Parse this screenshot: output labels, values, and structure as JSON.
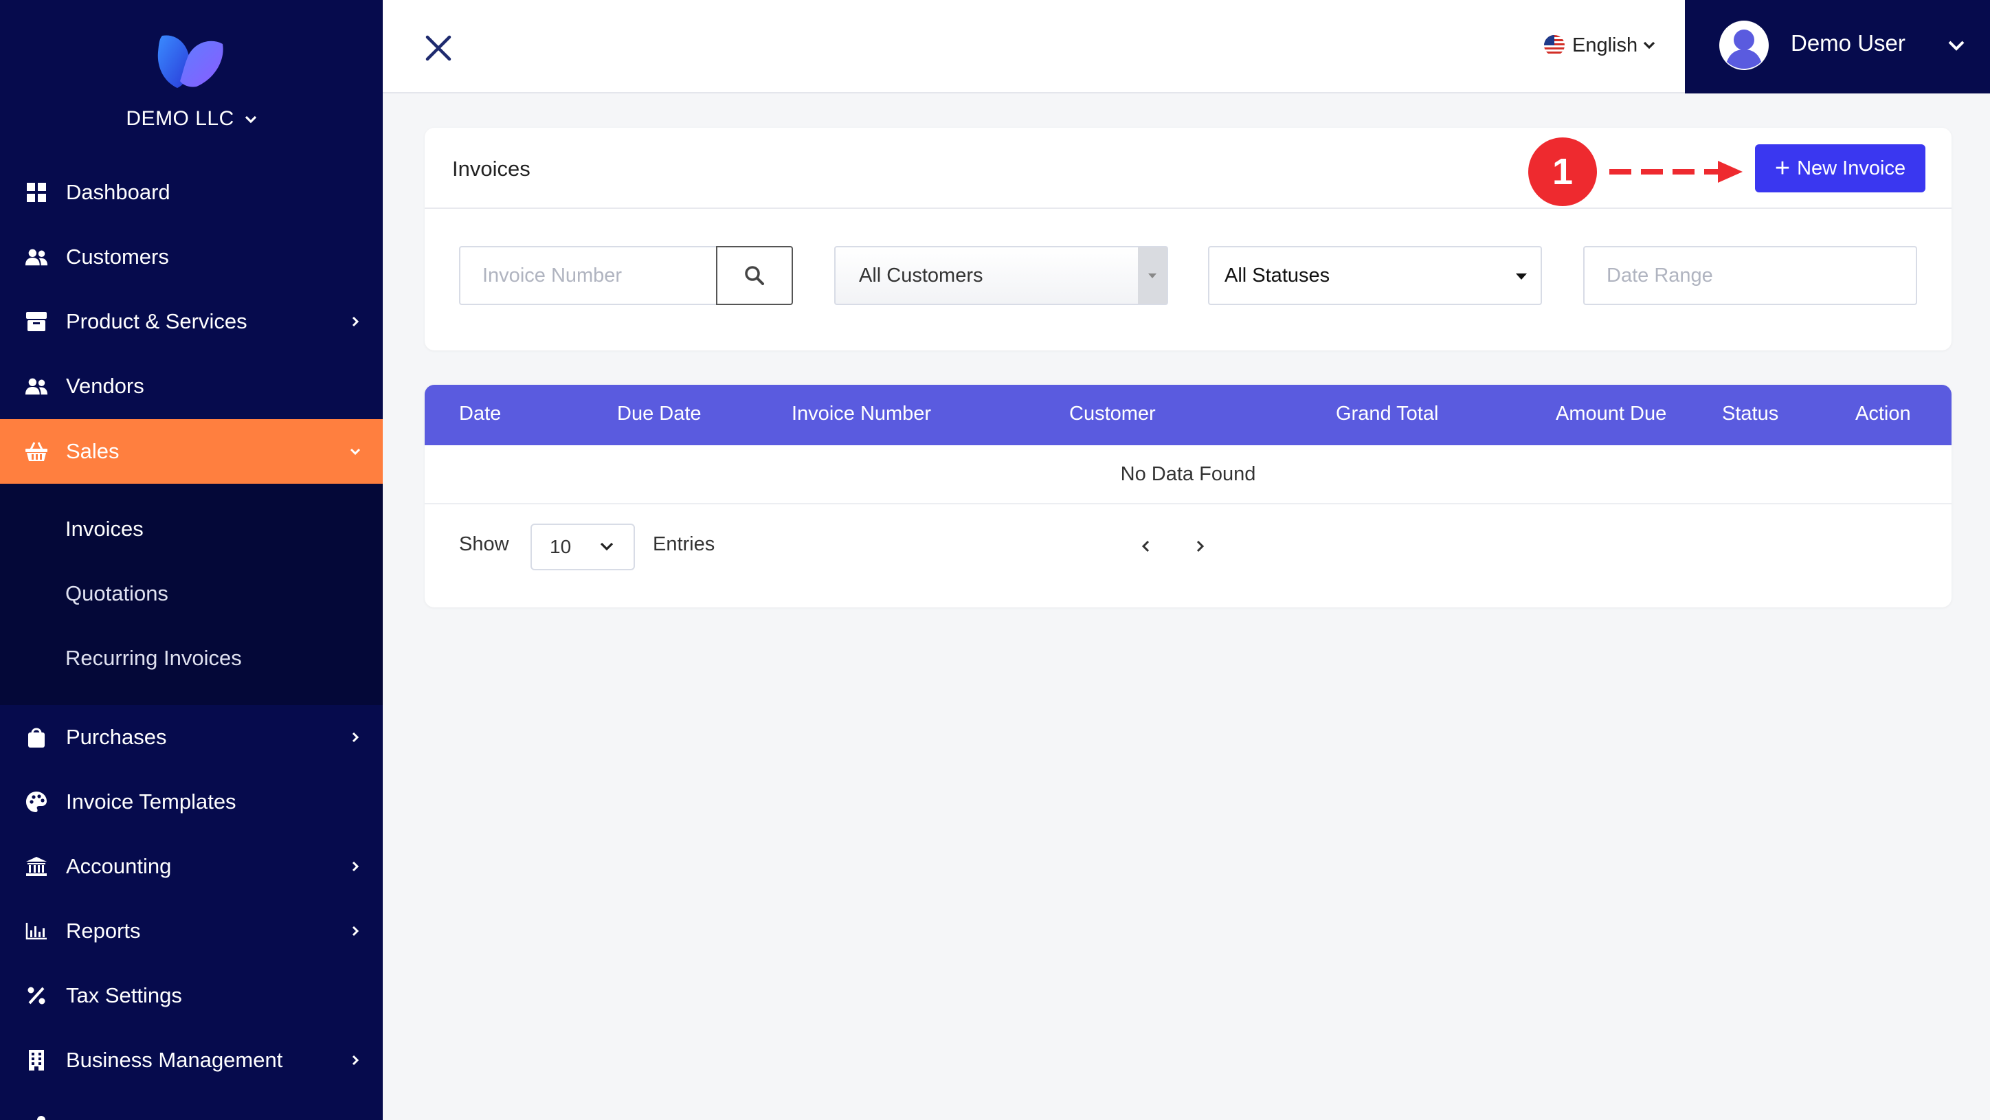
{
  "sidebar": {
    "company": "DEMO LLC",
    "items": [
      {
        "label": "Dashboard"
      },
      {
        "label": "Customers"
      },
      {
        "label": "Product & Services"
      },
      {
        "label": "Vendors"
      },
      {
        "label": "Sales"
      },
      {
        "label": "Purchases"
      },
      {
        "label": "Invoice Templates"
      },
      {
        "label": "Accounting"
      },
      {
        "label": "Reports"
      },
      {
        "label": "Tax Settings"
      },
      {
        "label": "Business Management"
      }
    ],
    "sales_submenu": [
      {
        "label": "Invoices"
      },
      {
        "label": "Quotations"
      },
      {
        "label": "Recurring Invoices"
      }
    ]
  },
  "topbar": {
    "language": "English",
    "user_name": "Demo User"
  },
  "invoices_card": {
    "title": "Invoices",
    "step_marker": "1",
    "new_button": "New Invoice",
    "filters": {
      "invoice_number_placeholder": "Invoice Number",
      "customer_select": "All Customers",
      "status_select": "All Statuses",
      "date_range_placeholder": "Date Range"
    }
  },
  "table": {
    "columns": [
      "Date",
      "Due Date",
      "Invoice Number",
      "Customer",
      "Grand Total",
      "Amount Due",
      "Status",
      "Action"
    ],
    "empty_message": "No Data Found",
    "show_label": "Show",
    "page_size": "10",
    "entries_label": "Entries"
  },
  "colors": {
    "sidebar_bg": "#060b4d",
    "active_item": "#ff7f3f",
    "primary_button": "#3a37f0",
    "table_header": "#5a5bdf",
    "marker": "#ee2a2f"
  }
}
